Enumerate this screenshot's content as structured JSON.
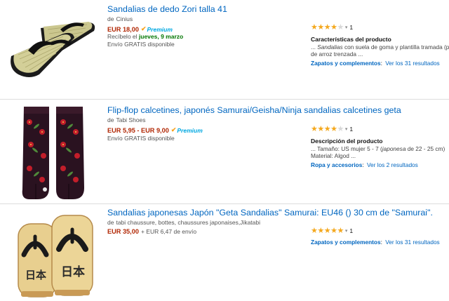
{
  "products": [
    {
      "title": "Sandalias de dedo Zori talla 41",
      "by_label": "de",
      "brand": "Cinius",
      "price": "EUR 18,00",
      "prime_label": "Premium",
      "delivery_prefix": "Recíbelo el",
      "delivery_date": "jueves, 9 marzo",
      "shipping": "Envío GRATIS disponible",
      "rating": 4,
      "review_count": "1",
      "desc_heading": "Características del producto",
      "desc_lines": [
        {
          "pre": "... ",
          "em": "Sandalias",
          "post": " con suela de goma y plantilla tramada (paja"
        },
        {
          "pre": "de arroz trenzada ...",
          "em": "",
          "post": ""
        }
      ],
      "category_name": "Zapatos y complementos",
      "category_link": "Ver los 31 resultados"
    },
    {
      "title": "Flip-flop calcetines, japonés Samurai/Geisha/Ninja sandalias calcetines geta",
      "by_label": "de",
      "brand": "Tabi Shoes",
      "price": "EUR 5,95 - EUR 9,00",
      "prime_label": "Premium",
      "shipping": "Envío GRATIS disponible",
      "rating": 4,
      "review_count": "1",
      "desc_heading": "Descripción del producto",
      "desc_lines": [
        {
          "pre": "... Tamaño: US mujer 5 - 7 (",
          "em": "japonesa",
          "post": " de 22 - 25 cm)"
        },
        {
          "pre": "Material: Algod ...",
          "em": "",
          "post": ""
        }
      ],
      "category_name": "Ropa y accesorios",
      "category_link": "Ver los 2 resultados"
    },
    {
      "title": "Sandalias japonesas Japón \"Geta Sandalias\" Samurai: EU46 () 30 cm de \"Samurai\".",
      "by_label": "de",
      "brand": "tabi chaussure, bottes, chaussures japonaises,Jikatabi",
      "price": "EUR 35,00",
      "shipping_fee": "+ EUR 6,47 de envío",
      "rating": 5,
      "review_count": "1",
      "category_name": "Zapatos y complementos",
      "category_link": "Ver los 31 resultados",
      "geta_glyph": "日本"
    }
  ],
  "colors": {
    "link": "#0066c0",
    "price": "#b12704",
    "star": "#f4a81d",
    "prime": "#00a8e1",
    "green": "#007600"
  },
  "icons": {
    "star": "★",
    "caret": "▾",
    "prime_check": "✔"
  }
}
